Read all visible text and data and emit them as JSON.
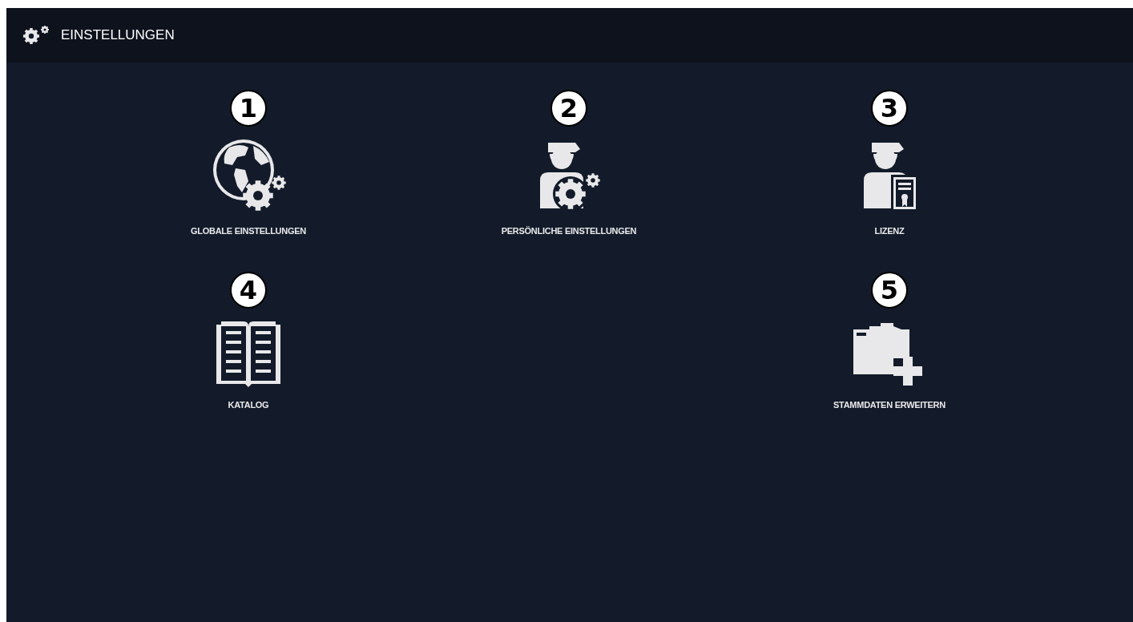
{
  "header": {
    "title": "EINSTELLUNGEN"
  },
  "rows": [
    [
      {
        "badge": "1",
        "kind": "globe",
        "label": "GLOBALE EINSTELLUNGEN"
      },
      {
        "badge": "2",
        "kind": "profile",
        "label": "PERSÖNLICHE EINSTELLUNGEN"
      },
      {
        "badge": "3",
        "kind": "license",
        "label": "LIZENZ"
      }
    ],
    [
      {
        "badge": "4",
        "kind": "catalog",
        "label": "KATALOG"
      },
      null,
      {
        "badge": "5",
        "kind": "masterdata",
        "label": "STAMMDATEN ERWEITERN"
      }
    ]
  ]
}
